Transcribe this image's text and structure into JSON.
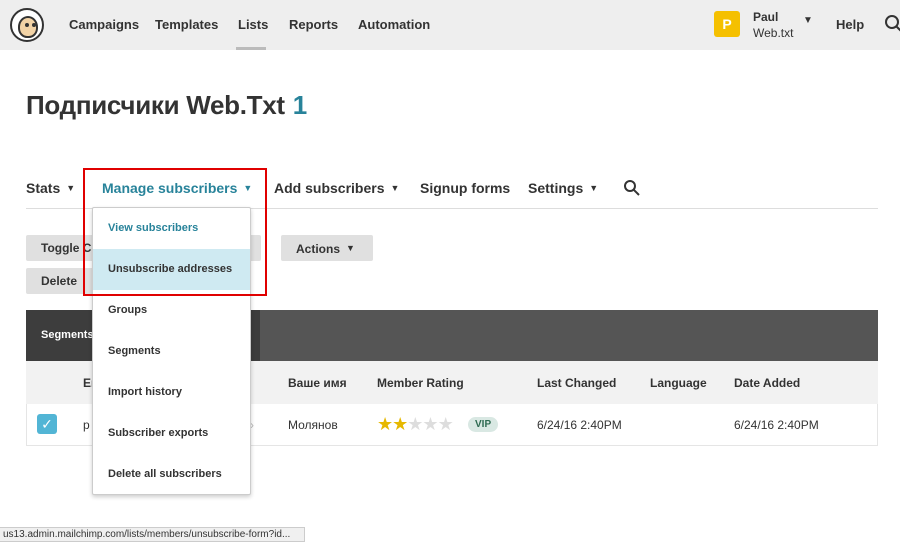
{
  "topnav": {
    "items": [
      "Campaigns",
      "Templates",
      "Lists",
      "Reports",
      "Automation"
    ],
    "user": {
      "avatar_letter": "P",
      "name": "Paul",
      "account": "Web.txt"
    },
    "help": "Help"
  },
  "page": {
    "title": "Подписчики Web.Txt",
    "count": "1"
  },
  "subnav": {
    "stats": "Stats",
    "manage": "Manage subscribers",
    "add": "Add subscribers",
    "signup": "Signup forms",
    "settings": "Settings"
  },
  "dropdown": {
    "items": [
      "View subscribers",
      "Unsubscribe addresses",
      "Groups",
      "Segments",
      "Import history",
      "Subscriber exports",
      "Delete all subscribers"
    ]
  },
  "buttons": {
    "toggle": "Toggle Co",
    "delete": "Delete",
    "actions": "Actions"
  },
  "table": {
    "segments_label": "Segments",
    "headers": [
      "Er",
      "Ваше имя",
      "Member Rating",
      "Last Changed",
      "Language",
      "Date Added"
    ],
    "rows": [
      {
        "email": "p",
        "name": "Молянов",
        "rating_stars": 2,
        "rating_max": 5,
        "badge": "VIP",
        "last_changed": "6/24/16 2:40PM",
        "language": "",
        "date_added": "6/24/16 2:40PM"
      }
    ]
  },
  "status_url": "us13.admin.mailchimp.com/lists/members/unsubscribe-form?id...",
  "colors": {
    "accent": "#28839a",
    "highlight": "#e00000",
    "hover": "#cfeaf2",
    "star": "#e6b800",
    "avatar": "#f5c000"
  }
}
